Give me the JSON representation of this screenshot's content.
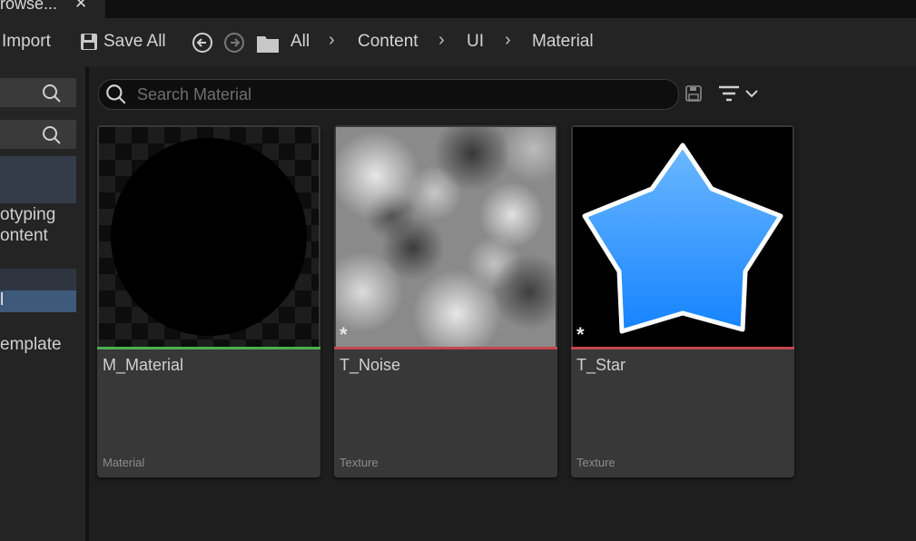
{
  "tab": {
    "title": "rowse...",
    "close": "✕"
  },
  "toolbar": {
    "import_label": "Import",
    "save_all_label": "Save All"
  },
  "breadcrumb": [
    "All",
    "Content",
    "UI",
    "Material"
  ],
  "left_panel": {
    "items": [
      "otyping",
      "ontent",
      "l",
      "emplate"
    ]
  },
  "search": {
    "placeholder": "Search Material"
  },
  "assets": [
    {
      "name": "M_Material",
      "type": "Material",
      "bar_color": "#4caf50"
    },
    {
      "name": "T_Noise",
      "type": "Texture",
      "bar_color": "#c2474f"
    },
    {
      "name": "T_Star",
      "type": "Texture",
      "bar_color": "#c2474f"
    }
  ],
  "colors": {
    "accent_selected": "#3d5a7a",
    "star_fill": "#2f95ff"
  }
}
